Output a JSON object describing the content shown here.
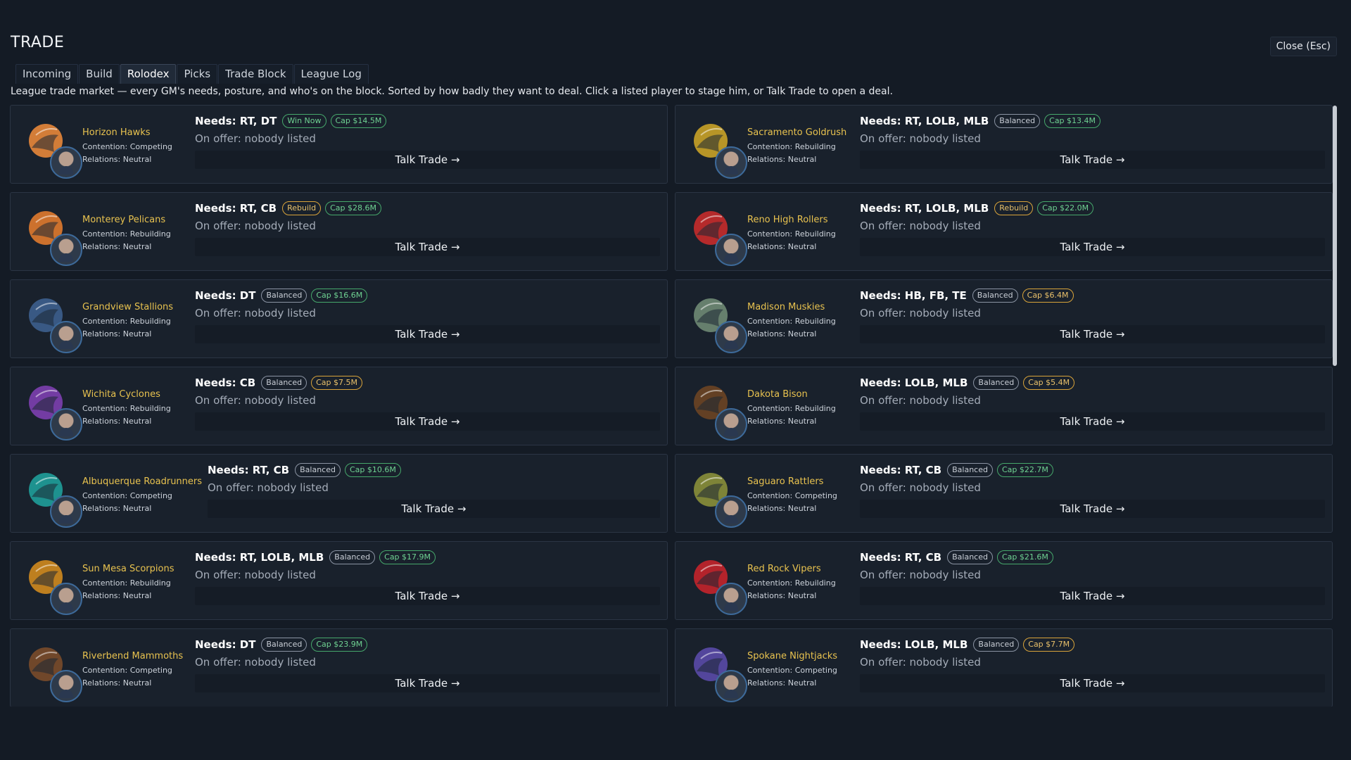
{
  "header": {
    "title": "TRADE",
    "close_label": "Close (Esc)"
  },
  "tabs": [
    "Incoming",
    "Build",
    "Rolodex",
    "Picks",
    "Trade Block",
    "League Log"
  ],
  "active_tab": "Rolodex",
  "description": "League trade market — every GM's needs, posture, and who's on the block. Sorted by how badly they want to deal. Click a listed player to stage him, or Talk Trade to open a deal.",
  "talk_label": "Talk Trade →",
  "teams": [
    {
      "name": "Horizon Hawks",
      "contention": "Contention: Competing",
      "relations": "Relations: Neutral",
      "needs": "Needs: RT, DT",
      "posture": "Win Now",
      "posture_kind": "win",
      "cap": "Cap $14.5M",
      "cap_kind": "high",
      "offer": "On offer: nobody listed",
      "logo_icon": "hawk-logo-icon",
      "logo_color": "#e8873a"
    },
    {
      "name": "Sacramento Goldrush",
      "contention": "Contention: Rebuilding",
      "relations": "Relations: Neutral",
      "needs": "Needs: RT, LOLB, MLB",
      "posture": "Balanced",
      "posture_kind": "balanced",
      "cap": "Cap $13.4M",
      "cap_kind": "high",
      "offer": "On offer: nobody listed",
      "logo_icon": "gold-cart-logo-icon",
      "logo_color": "#c9a227"
    },
    {
      "name": "Monterey Pelicans",
      "contention": "Contention: Rebuilding",
      "relations": "Relations: Neutral",
      "needs": "Needs: RT, CB",
      "posture": "Rebuild",
      "posture_kind": "rebuild",
      "cap": "Cap $28.6M",
      "cap_kind": "high",
      "offer": "On offer: nobody listed",
      "logo_icon": "pelican-logo-icon",
      "logo_color": "#e07a2e"
    },
    {
      "name": "Reno High Rollers",
      "contention": "Contention: Rebuilding",
      "relations": "Relations: Neutral",
      "needs": "Needs: RT, LOLB, MLB",
      "posture": "Rebuild",
      "posture_kind": "rebuild",
      "cap": "Cap $22.0M",
      "cap_kind": "high",
      "offer": "On offer: nobody listed",
      "logo_icon": "dice-logo-icon",
      "logo_color": "#c62b2b"
    },
    {
      "name": "Grandview Stallions",
      "contention": "Contention: Rebuilding",
      "relations": "Relations: Neutral",
      "needs": "Needs: DT",
      "posture": "Balanced",
      "posture_kind": "balanced",
      "cap": "Cap $16.6M",
      "cap_kind": "high",
      "offer": "On offer: nobody listed",
      "logo_icon": "stallion-logo-icon",
      "logo_color": "#3d5f8e"
    },
    {
      "name": "Madison Muskies",
      "contention": "Contention: Rebuilding",
      "relations": "Relations: Neutral",
      "needs": "Needs: HB, FB, TE",
      "posture": "Balanced",
      "posture_kind": "balanced",
      "cap": "Cap $6.4M",
      "cap_kind": "low",
      "offer": "On offer: nobody listed",
      "logo_icon": "muskie-fish-logo-icon",
      "logo_color": "#6f8a74"
    },
    {
      "name": "Wichita Cyclones",
      "contention": "Contention: Rebuilding",
      "relations": "Relations: Neutral",
      "needs": "Needs: CB",
      "posture": "Balanced",
      "posture_kind": "balanced",
      "cap": "Cap $7.5M",
      "cap_kind": "low",
      "offer": "On offer: nobody listed",
      "logo_icon": "cyclone-logo-icon",
      "logo_color": "#7d3fb0"
    },
    {
      "name": "Dakota Bison",
      "contention": "Contention: Rebuilding",
      "relations": "Relations: Neutral",
      "needs": "Needs: LOLB, MLB",
      "posture": "Balanced",
      "posture_kind": "balanced",
      "cap": "Cap $5.4M",
      "cap_kind": "low",
      "offer": "On offer: nobody listed",
      "logo_icon": "bison-logo-icon",
      "logo_color": "#6b4423"
    },
    {
      "name": "Albuquerque Roadrunners",
      "contention": "Contention: Competing",
      "relations": "Relations: Neutral",
      "needs": "Needs: RT, CB",
      "posture": "Balanced",
      "posture_kind": "balanced",
      "cap": "Cap $10.6M",
      "cap_kind": "high",
      "offer": "On offer: nobody listed",
      "logo_icon": "roadrunner-logo-icon",
      "logo_color": "#1f9e9a"
    },
    {
      "name": "Saguaro Rattlers",
      "contention": "Contention: Competing",
      "relations": "Relations: Neutral",
      "needs": "Needs: RT, CB",
      "posture": "Balanced",
      "posture_kind": "balanced",
      "cap": "Cap $22.7M",
      "cap_kind": "high",
      "offer": "On offer: nobody listed",
      "logo_icon": "rattlesnake-cactus-logo-icon",
      "logo_color": "#8a8f3a"
    },
    {
      "name": "Sun Mesa Scorpions",
      "contention": "Contention: Rebuilding",
      "relations": "Relations: Neutral",
      "needs": "Needs: RT, LOLB, MLB",
      "posture": "Balanced",
      "posture_kind": "balanced",
      "cap": "Cap $17.9M",
      "cap_kind": "high",
      "offer": "On offer: nobody listed",
      "logo_icon": "scorpion-logo-icon",
      "logo_color": "#d08a1e"
    },
    {
      "name": "Red Rock Vipers",
      "contention": "Contention: Rebuilding",
      "relations": "Relations: Neutral",
      "needs": "Needs: RT, CB",
      "posture": "Balanced",
      "posture_kind": "balanced",
      "cap": "Cap $21.6M",
      "cap_kind": "high",
      "offer": "On offer: nobody listed",
      "logo_icon": "viper-logo-icon",
      "logo_color": "#c4232b"
    },
    {
      "name": "Riverbend Mammoths",
      "contention": "Contention: Competing",
      "relations": "Relations: Neutral",
      "needs": "Needs: DT",
      "posture": "Balanced",
      "posture_kind": "balanced",
      "cap": "Cap $23.9M",
      "cap_kind": "high",
      "offer": "On offer: nobody listed",
      "logo_icon": "mammoth-logo-icon",
      "logo_color": "#7a4b2a"
    },
    {
      "name": "Spokane Nightjacks",
      "contention": "Contention: Competing",
      "relations": "Relations: Neutral",
      "needs": "Needs: LOLB, MLB",
      "posture": "Balanced",
      "posture_kind": "balanced",
      "cap": "Cap $7.7M",
      "cap_kind": "low",
      "offer": "On offer: nobody listed",
      "logo_icon": "jackrabbit-logo-icon",
      "logo_color": "#5a4aa8"
    }
  ]
}
